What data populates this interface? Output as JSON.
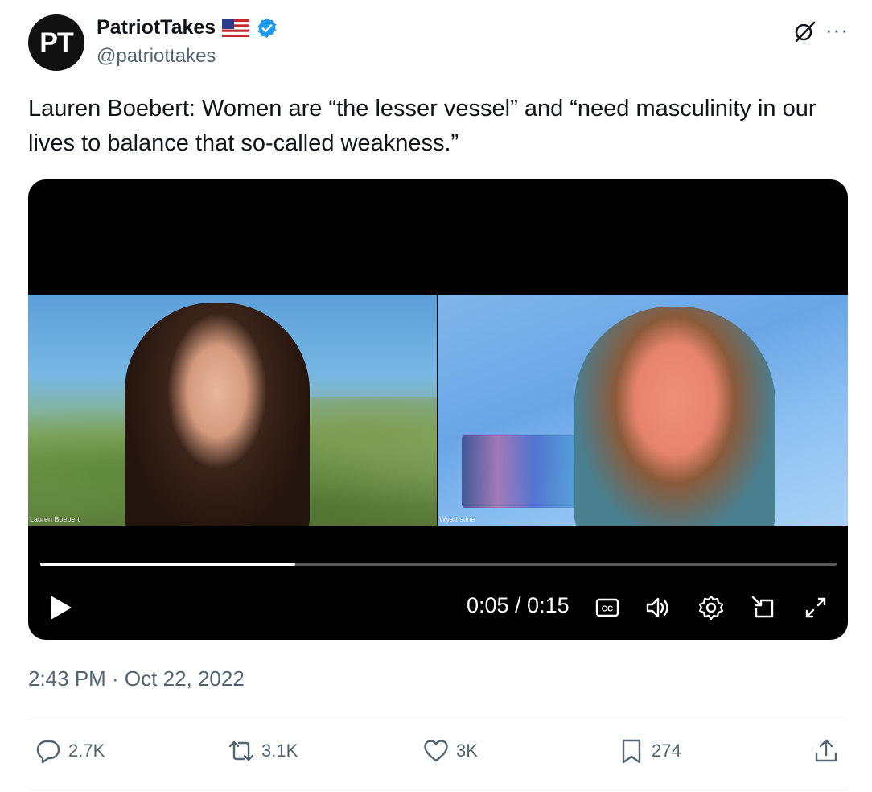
{
  "author": {
    "avatar_text": "PT",
    "display_name": "PatriotTakes",
    "handle": "@patriottakes"
  },
  "icons": {
    "flag": "us-flag-icon",
    "verified": "verified-badge-icon",
    "grok": "grok-icon",
    "more": "more-icon"
  },
  "tweet": {
    "text": "Lauren Boebert: Women are “the lesser vessel” and “need masculinity in our lives to balance that so-called weakness.”",
    "timestamp": "2:43 PM · Oct 22, 2022"
  },
  "video": {
    "left_label": "Lauren Boebert",
    "right_label": "Wyatt stina",
    "current_time": "0:05",
    "duration": "0:15",
    "time_display": "0:05 / 0:15",
    "progress_fraction": 0.32
  },
  "actions": {
    "replies": "2.7K",
    "reposts": "3.1K",
    "likes": "3K",
    "bookmarks": "274"
  },
  "colors": {
    "text": "#0f1419",
    "secondary": "#536471",
    "verified_blue": "#1d9bf0",
    "video_bg": "#000000"
  }
}
